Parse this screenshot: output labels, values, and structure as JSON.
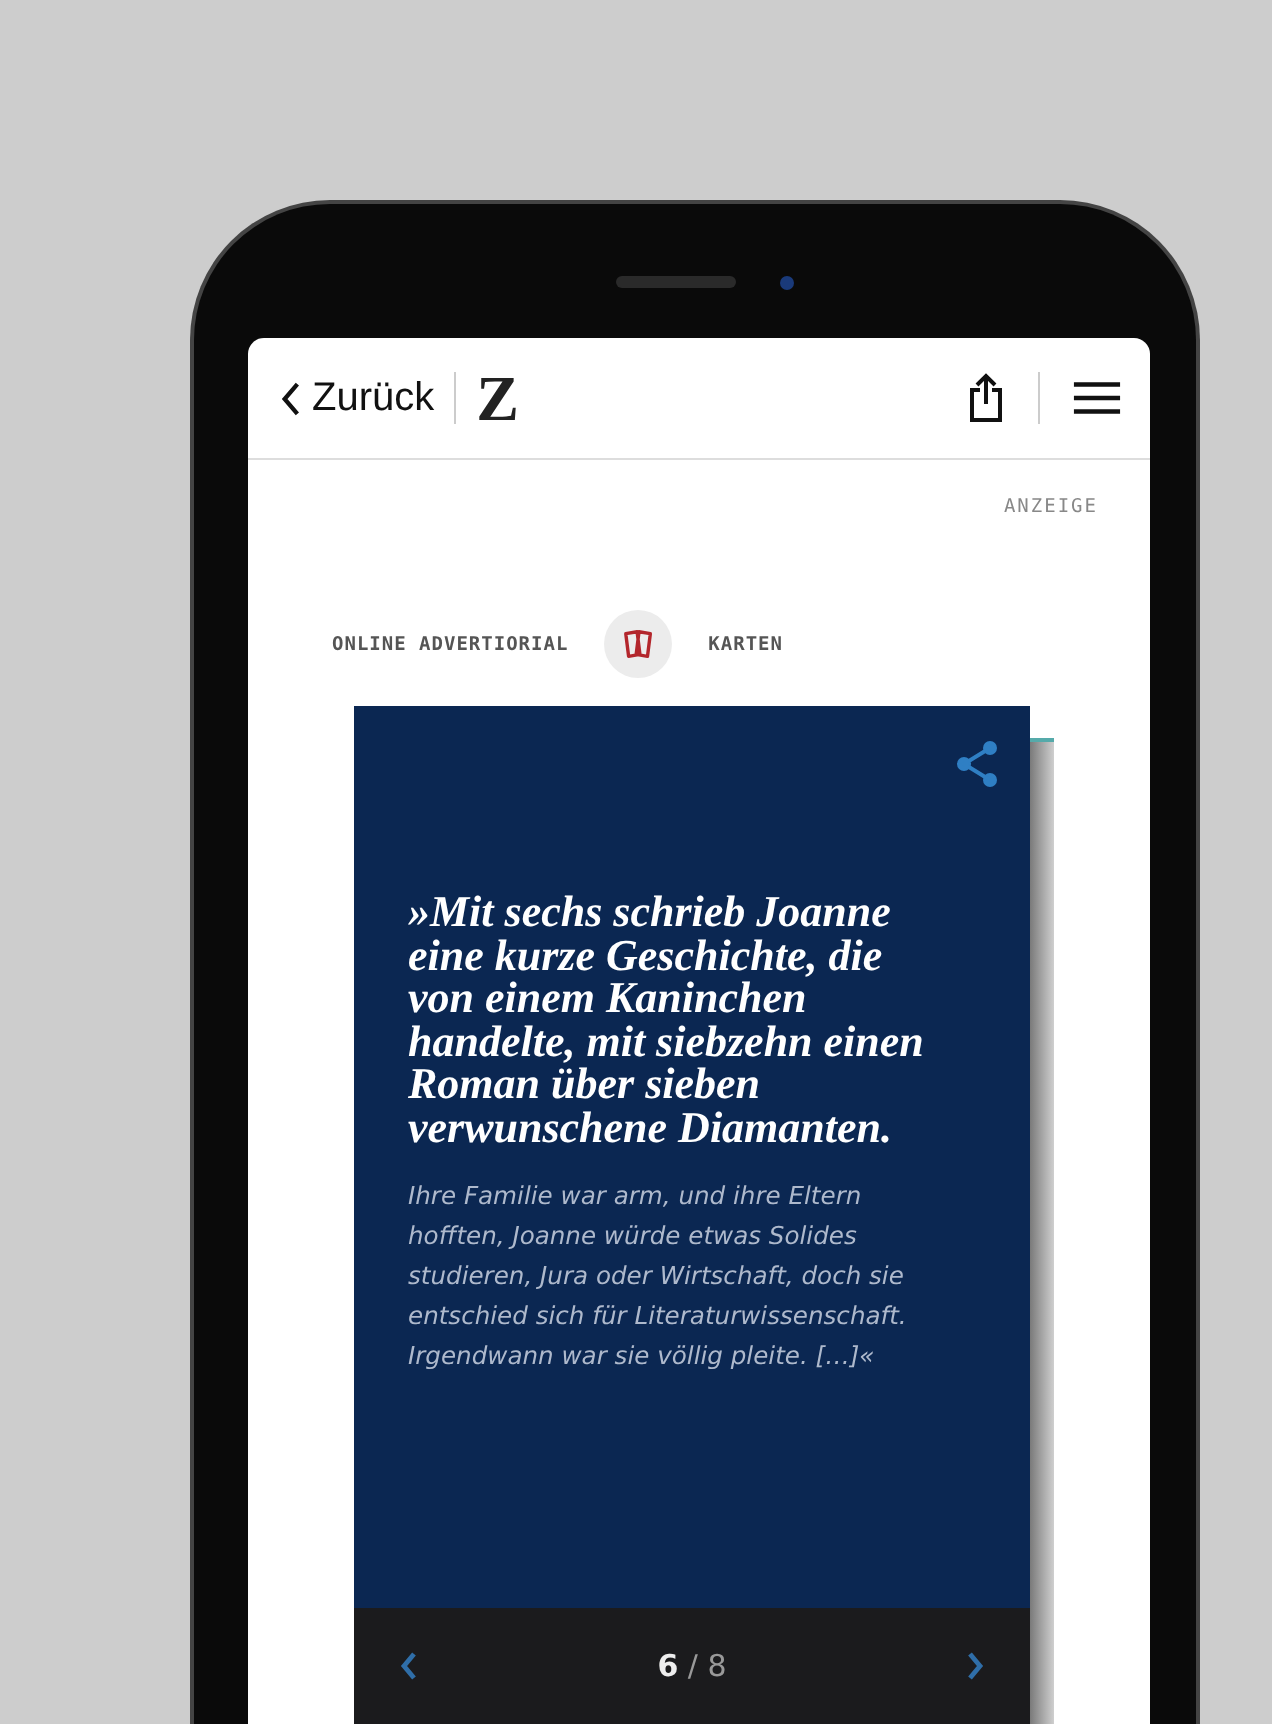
{
  "header": {
    "back_label": "Zurück",
    "logo": "Z"
  },
  "ad_label": "ANZEIGE",
  "tags": {
    "left": "ONLINE ADVERTIORIAL",
    "right": "KARTEN"
  },
  "card": {
    "quote": "»Mit sechs schrieb Joanne eine kurze Geschichte, die von einem Kaninchen handelte, mit siebzehn einen Roman über sieben verwunschene Diamanten.",
    "body": "Ihre Familie war arm, und ihre Eltern hofften, Joanne würde etwas Solides studieren, Jura oder Wirtschaft, doch sie entschied sich für Literaturwissenschaft. Irgendwann war sie völlig pleite. […]«",
    "pager": {
      "current": "6",
      "separator": "/",
      "total": "8"
    }
  }
}
